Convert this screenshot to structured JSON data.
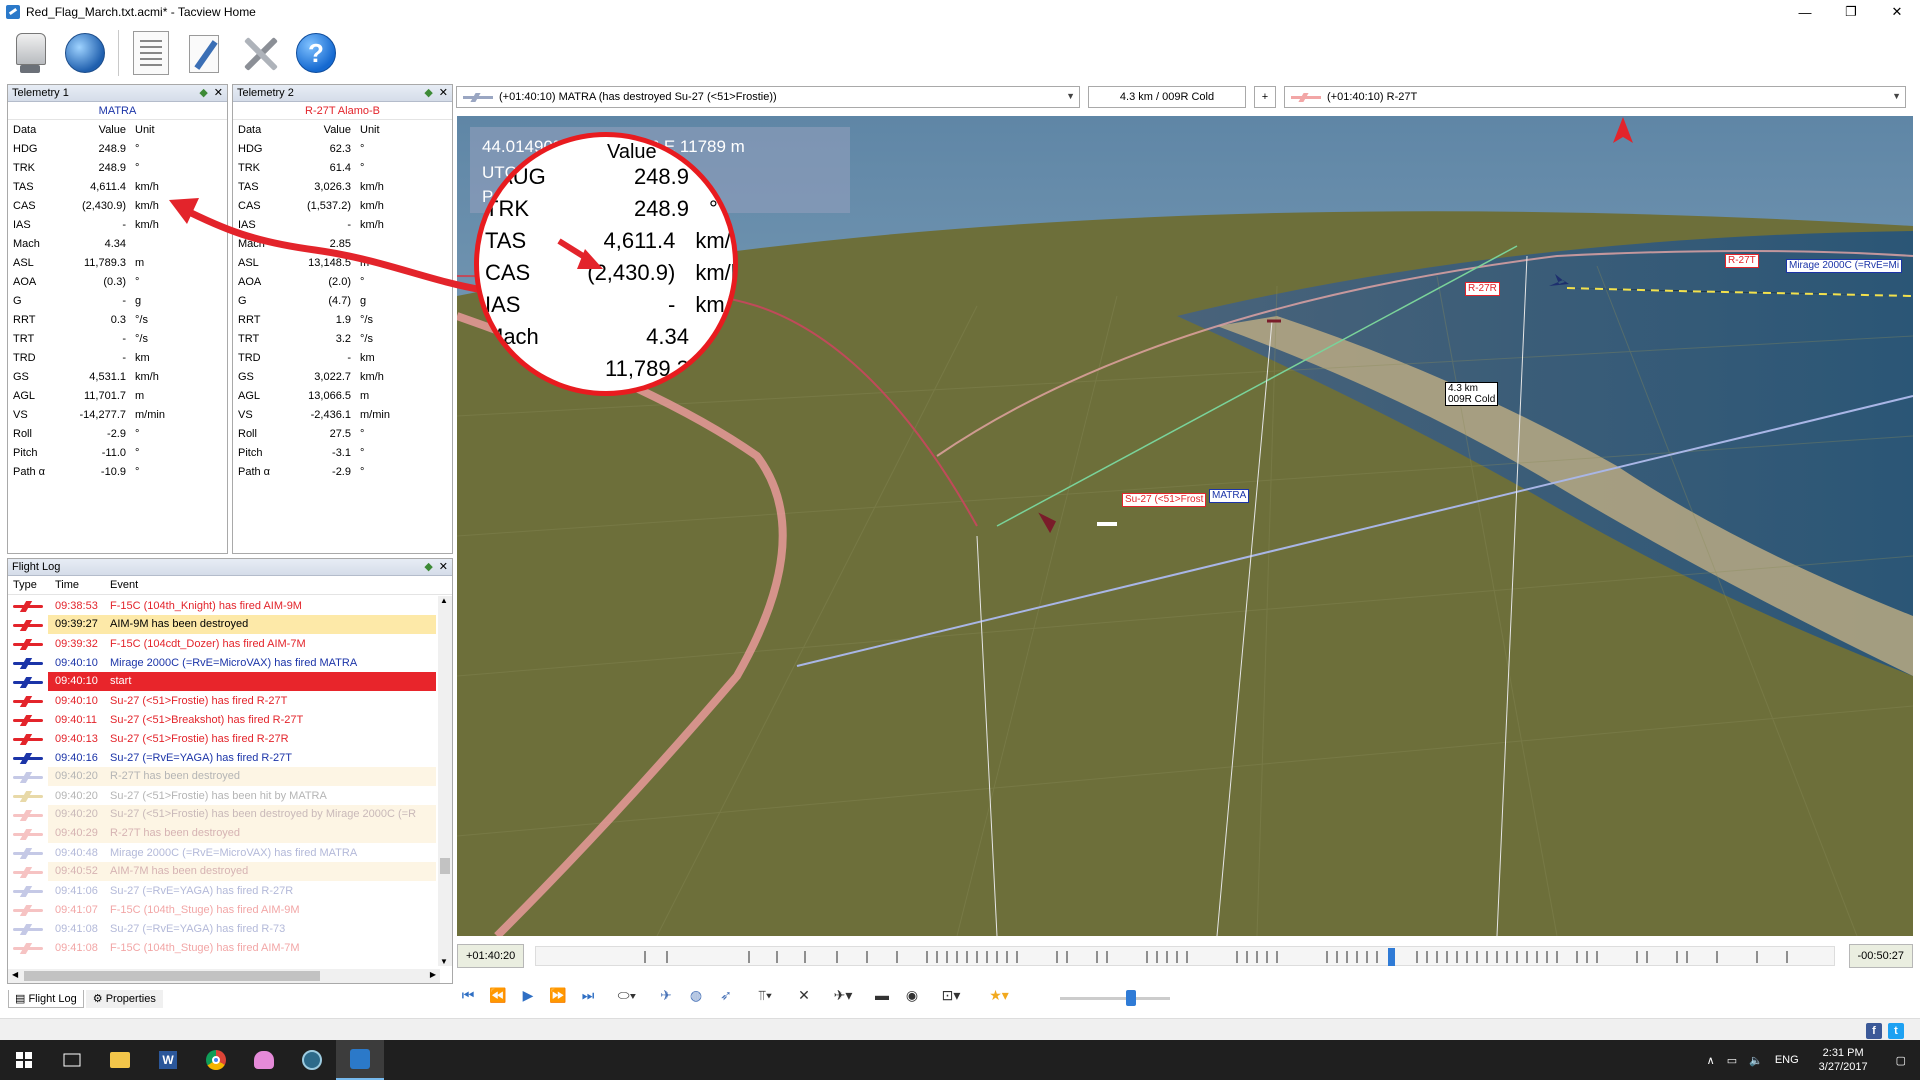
{
  "window": {
    "title": "Red_Flag_March.txt.acmi* - Tacview Home",
    "min": "—",
    "restore": "❐",
    "close": "✕"
  },
  "toolbar": {
    "icons": [
      "database-icon",
      "globe-icon",
      "document-icon",
      "edit-icon",
      "tools-icon",
      "help-icon"
    ],
    "help_glyph": "?"
  },
  "telemetry1": {
    "title": "Telemetry 1",
    "object": "MATRA",
    "object_color": "#1b34a8",
    "headers": [
      "Data",
      "Value",
      "Unit"
    ],
    "rows": [
      [
        "HDG",
        "248.9",
        "°"
      ],
      [
        "TRK",
        "248.9",
        "°"
      ],
      [
        "TAS",
        "4,611.4",
        "km/h"
      ],
      [
        "CAS",
        "(2,430.9)",
        "km/h"
      ],
      [
        "IAS",
        "-",
        "km/h"
      ],
      [
        "Mach",
        "4.34",
        ""
      ],
      [
        "ASL",
        "11,789.3",
        "m"
      ],
      [
        "AOA",
        "(0.3)",
        "°"
      ],
      [
        "G",
        "-",
        "g"
      ],
      [
        "RRT",
        "0.3",
        "°/s"
      ],
      [
        "TRT",
        "-",
        "°/s"
      ],
      [
        "TRD",
        "-",
        "km"
      ],
      [
        "GS",
        "4,531.1",
        "km/h"
      ],
      [
        "AGL",
        "11,701.7",
        "m"
      ],
      [
        "VS",
        "-14,277.7",
        "m/min"
      ],
      [
        "Roll",
        "-2.9",
        "°"
      ],
      [
        "Pitch",
        "-11.0",
        "°"
      ],
      [
        "Path α",
        "-10.9",
        "°"
      ]
    ]
  },
  "telemetry2": {
    "title": "Telemetry 2",
    "object": "R-27T Alamo-B",
    "object_color": "#e3242b",
    "headers": [
      "Data",
      "Value",
      "Unit"
    ],
    "rows": [
      [
        "HDG",
        "62.3",
        "°"
      ],
      [
        "TRK",
        "61.4",
        "°"
      ],
      [
        "TAS",
        "3,026.3",
        "km/h"
      ],
      [
        "CAS",
        "(1,537.2)",
        "km/h"
      ],
      [
        "IAS",
        "-",
        "km/h"
      ],
      [
        "Mach",
        "2.85",
        ""
      ],
      [
        "ASL",
        "13,148.5",
        "m"
      ],
      [
        "AOA",
        "(2.0)",
        "°"
      ],
      [
        "G",
        "(4.7)",
        "g"
      ],
      [
        "RRT",
        "1.9",
        "°/s"
      ],
      [
        "TRT",
        "3.2",
        "°/s"
      ],
      [
        "TRD",
        "-",
        "km"
      ],
      [
        "GS",
        "3,022.7",
        "km/h"
      ],
      [
        "AGL",
        "13,066.5",
        "m"
      ],
      [
        "VS",
        "-2,436.1",
        "m/min"
      ],
      [
        "Roll",
        "27.5",
        "°"
      ],
      [
        "Pitch",
        "-3.1",
        "°"
      ],
      [
        "Path α",
        "-2.9",
        "°"
      ]
    ]
  },
  "flightlog": {
    "title": "Flight Log",
    "headers": [
      "Type",
      "Time",
      "Event"
    ],
    "rows": [
      {
        "time": "09:38:53",
        "event": "F-15C (104th_Knight) has fired AIM-9M",
        "color": "#e3242b",
        "bg": "",
        "icon": "#e3242b"
      },
      {
        "time": "09:39:27",
        "event": "AIM-9M has been destroyed",
        "color": "#000000",
        "bg": "#fde9a8",
        "icon": "#e3242b"
      },
      {
        "time": "09:39:32",
        "event": "F-15C (104cdt_Dozer) has fired AIM-7M",
        "color": "#e3242b",
        "bg": "",
        "icon": "#e3242b"
      },
      {
        "time": "09:40:10",
        "event": "Mirage 2000C (=RvE=MicroVAX) has fired MATRA",
        "color": "#1b34a8",
        "bg": "",
        "icon": "#1b34a8"
      },
      {
        "time": "09:40:10",
        "event": "start",
        "color": "#ffffff",
        "bg": "#e8252b",
        "icon": "#1b34a8"
      },
      {
        "time": "09:40:10",
        "event": "Su-27 (<51>Frostie) has fired R-27T",
        "color": "#e3242b",
        "bg": "",
        "icon": "#e3242b"
      },
      {
        "time": "09:40:11",
        "event": "Su-27 (<51>Breakshot) has fired R-27T",
        "color": "#e3242b",
        "bg": "",
        "icon": "#e3242b"
      },
      {
        "time": "09:40:13",
        "event": "Su-27 (<51>Frostie) has fired R-27R",
        "color": "#e3242b",
        "bg": "",
        "icon": "#e3242b"
      },
      {
        "time": "09:40:16",
        "event": "Su-27 (=RvE=YAGA) has fired R-27T",
        "color": "#1b34a8",
        "bg": "",
        "icon": "#1b34a8"
      },
      {
        "time": "09:40:20",
        "event": "R-27T has been destroyed",
        "color": "#b5b5b5",
        "bg": "#fdf5e4",
        "icon": "#c5c9e6"
      },
      {
        "time": "09:40:20",
        "event": "Su-27 (<51>Frostie) has been hit by MATRA",
        "color": "#b5b5b5",
        "bg": "",
        "icon": "#e8d9a8"
      },
      {
        "time": "09:40:20",
        "event": "Su-27 (<51>Frostie) has been destroyed by Mirage 2000C (=R",
        "color": "#c9b9b9",
        "bg": "#fdf5e4",
        "icon": "#f6c3c3"
      },
      {
        "time": "09:40:29",
        "event": "R-27T has been destroyed",
        "color": "#d6b3b3",
        "bg": "#fdf5e4",
        "icon": "#f6c3c3"
      },
      {
        "time": "09:40:48",
        "event": "Mirage 2000C (=RvE=MicroVAX) has fired MATRA",
        "color": "#b3b9d9",
        "bg": "",
        "icon": "#c5c9e6"
      },
      {
        "time": "09:40:52",
        "event": "AIM-7M has been destroyed",
        "color": "#d6b3b3",
        "bg": "#fdf5e4",
        "icon": "#f6c3c3"
      },
      {
        "time": "09:41:06",
        "event": "Su-27 (=RvE=YAGA) has fired R-27R",
        "color": "#b3b9d9",
        "bg": "",
        "icon": "#c5c9e6"
      },
      {
        "time": "09:41:07",
        "event": "F-15C (104th_Stuge) has fired AIM-9M",
        "color": "#f2a6a6",
        "bg": "",
        "icon": "#f6c3c3"
      },
      {
        "time": "09:41:08",
        "event": "Su-27 (=RvE=YAGA) has fired R-73",
        "color": "#b3b9d9",
        "bg": "",
        "icon": "#c5c9e6"
      },
      {
        "time": "09:41:08",
        "event": "F-15C (104th_Stuge) has fired AIM-7M",
        "color": "#f2a6a6",
        "bg": "",
        "icon": "#f6c3c3"
      }
    ]
  },
  "bottom_tabs": [
    "Flight Log",
    "Properties"
  ],
  "view_header": {
    "left_combo": "(+01:40:10) MATRA (has destroyed Su-27 (<51>Frostie))",
    "distance": "4.3 km / 009R Cold",
    "plus": "+",
    "right_combo": "(+01:40:10) R-27T"
  },
  "hud": {
    "line1": "44.01490° N  45.25574° E  11789 m",
    "line2": "UTC 1",
    "line3": "PAUG"
  },
  "magnifier": {
    "header_value": "Value",
    "rows": [
      [
        "PAUG",
        "248.9",
        "°"
      ],
      [
        "TRK",
        "248.9",
        "°"
      ],
      [
        "TAS",
        "4,611.4",
        "km/h"
      ],
      [
        "CAS",
        "(2,430.9)",
        "km/h"
      ],
      [
        "IAS",
        "-",
        "km/h"
      ],
      [
        "Mach",
        "4.34",
        ""
      ],
      [
        "",
        "11,789.3",
        ""
      ]
    ]
  },
  "view_tags": {
    "r27t": "R-27T",
    "r27r": "R-27R",
    "mirage": "Mirage 2000C (=RvE=Mi",
    "dist1": "4.3 km",
    "dist2": "009R Cold",
    "su27": "Su-27 (<51>Frost",
    "matra": "MATRA"
  },
  "timeline": {
    "elapsed": "+01:40:20",
    "remaining": "-00:50:27",
    "position_fraction": 0.655
  },
  "statusbar": {
    "social": [
      "f",
      "t"
    ]
  },
  "taskbar": {
    "apps": [
      "windows-icon",
      "task-view-icon",
      "file-explorer-icon",
      "word-icon",
      "chrome-icon",
      "octopus-app-icon",
      "media-icon",
      "tacview-icon"
    ],
    "lang": "ENG",
    "time": "2:31 PM",
    "date": "3/27/2017"
  },
  "colors": {
    "accent": "#2f7bd6",
    "red": "#e3242b",
    "blue": "#1b34a8",
    "terrain": "#6a6c36"
  }
}
